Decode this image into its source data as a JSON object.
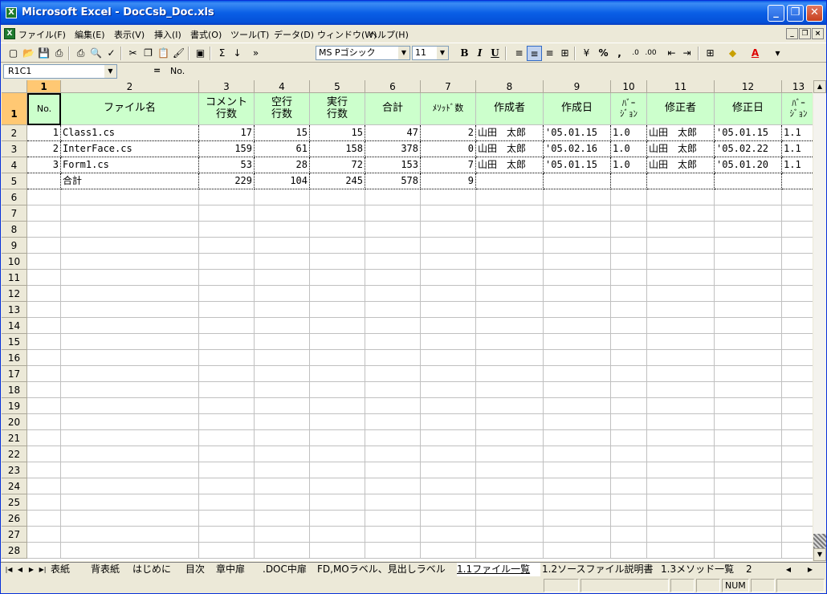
{
  "window": {
    "title": "Microsoft Excel - DocCsb_Doc.xls",
    "app_icon": "excel-icon",
    "buttons": {
      "minimize": "_",
      "restore": "❐",
      "close": "✕"
    }
  },
  "menu": {
    "items": [
      "ファイル(F)",
      "編集(E)",
      "表示(V)",
      "挿入(I)",
      "書式(O)",
      "ツール(T)",
      "データ(D)",
      "ウィンドウ(W)",
      "ヘルプ(H)"
    ],
    "doc_buttons": {
      "minimize": "_",
      "restore": "❐",
      "close": "×"
    }
  },
  "toolbar": {
    "font_name": "MS Pゴシック",
    "font_size": "11",
    "bold": "B",
    "italic": "I",
    "underline": "U",
    "sum": "Σ",
    "percent": "%",
    "comma": ","
  },
  "formula_bar": {
    "name_box": "R1C1",
    "equals": "=",
    "value": "No."
  },
  "columns": [
    "1",
    "2",
    "3",
    "4",
    "5",
    "6",
    "7",
    "8",
    "9",
    "10",
    "11",
    "12",
    "13"
  ],
  "rows": [
    "1",
    "2",
    "3",
    "4",
    "5",
    "6",
    "7",
    "8",
    "9",
    "10",
    "11",
    "12",
    "13",
    "14",
    "15",
    "16",
    "17",
    "18",
    "19",
    "20",
    "21",
    "22",
    "23",
    "24",
    "25",
    "26",
    "27",
    "28"
  ],
  "table": {
    "headers": [
      "No.",
      "ファイル名",
      "コメント\n行数",
      "空行\n行数",
      "実行\n行数",
      "合計",
      "ﾒｿｯﾄﾞ数",
      "作成者",
      "作成日",
      "ﾊﾞｰ\nｼﾞｮﾝ",
      "修正者",
      "修正日",
      "ﾊﾞｰ\nｼﾞｮﾝ"
    ],
    "rows": [
      [
        "1",
        "Class1.cs",
        "17",
        "15",
        "15",
        "47",
        "2",
        "山田　太郎",
        "'05.01.15",
        "1.0",
        "山田　太郎",
        "'05.01.15",
        "1.1"
      ],
      [
        "2",
        "InterFace.cs",
        "159",
        "61",
        "158",
        "378",
        "0",
        "山田　太郎",
        "'05.02.16",
        "1.0",
        "山田　太郎",
        "'05.02.22",
        "1.1"
      ],
      [
        "3",
        "Form1.cs",
        "53",
        "28",
        "72",
        "153",
        "7",
        "山田　太郎",
        "'05.01.15",
        "1.0",
        "山田　太郎",
        "'05.01.20",
        "1.1"
      ],
      [
        "",
        "合計",
        "229",
        "104",
        "245",
        "578",
        "9",
        "",
        "",
        "",
        "",
        "",
        ""
      ]
    ]
  },
  "sheet_tabs": [
    "表紙",
    "背表紙",
    "はじめに",
    "目次",
    "章中扉",
    ".DOC中扉",
    "FD,MOラベル、見出しラベル",
    "1.1ファイル一覧",
    "1.2ソースファイル説明書",
    "1.3メソッド一覧",
    "2"
  ],
  "active_sheet": "1.1ファイル一覧",
  "status": {
    "num": "NUM"
  }
}
